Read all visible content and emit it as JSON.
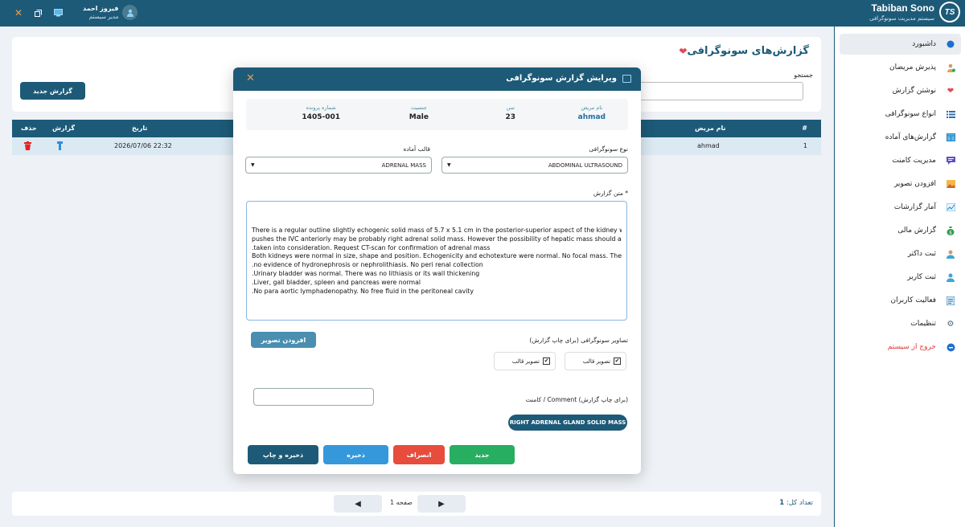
{
  "topbar": {
    "brand_title": "Tabiban Sono",
    "brand_subtitle": "سیستم مدیریت سونوگرافی",
    "logo_text": "TS",
    "user_name": "فیروز احمد",
    "user_role": "مدیر سیستم"
  },
  "sidebar": {
    "items": [
      {
        "label": "داشبورد",
        "icon": "dashboard-icon"
      },
      {
        "label": "پذیرش مریضان",
        "icon": "patient-add-icon"
      },
      {
        "label": "نوشتن گزارش",
        "icon": "heart-icon"
      },
      {
        "label": "انواع سونوگرافی",
        "icon": "list-icon"
      },
      {
        "label": "گزارش‌های آماده",
        "icon": "template-icon"
      },
      {
        "label": "مدیریت کامنت",
        "icon": "comment-icon"
      },
      {
        "label": "افزودن تصویر",
        "icon": "image-icon"
      },
      {
        "label": "آمار گزارشات",
        "icon": "chart-icon"
      },
      {
        "label": "گزارش مالی",
        "icon": "money-icon"
      },
      {
        "label": "ثبت داکتر",
        "icon": "doctor-icon"
      },
      {
        "label": "ثبت کاربر",
        "icon": "user-icon"
      },
      {
        "label": "فعالیت کاربران",
        "icon": "activity-icon"
      },
      {
        "label": "تنظیمات",
        "icon": "gear-icon"
      },
      {
        "label": "خروج از سیستم",
        "icon": "logout-icon"
      }
    ]
  },
  "page": {
    "title": "گزارش‌های سونوگرافی",
    "search_label": "جستجو",
    "new_report_button": "گزارش جدید"
  },
  "table": {
    "headers": {
      "index": "#",
      "patient": "نام مریض",
      "date": "تاریخ",
      "report": "گزارش",
      "delete": "حذف"
    },
    "rows": [
      {
        "index": "1",
        "patient": "ahmad",
        "date": "2026/07/06 22:32"
      }
    ]
  },
  "pagination": {
    "page_label": "صفحه 1",
    "total_label": "تعداد کل:",
    "total_value": "1"
  },
  "modal": {
    "title": "ویرایش گزارش سونوگرافی",
    "patient_info": {
      "name_label": "نام مریض",
      "name": "ahmad",
      "age_label": "سن",
      "age": "23",
      "gender_label": "جنسیت",
      "gender": "Male",
      "file_label": "شماره پرونده",
      "file_no": "1405-001"
    },
    "sono_type_label": "نوع سونوگرافی",
    "sono_type_value": "ABDOMINAL ULTRASOUND",
    "template_label": "قالب آماده",
    "template_value": "ADRENAL MASS",
    "report_text_label": "متن گزارش *",
    "report_lines": [
      "There is a regular outline slightly echogenic solid mass of 5.7 x 5.1 cm in the posterior-superior aspect of the kidney which",
      "pushes the IVC anteriorly may be probably right adrenal solid mass. However the possibility of hepatic mass should also be",
      ".taken into consideration. Request CT-scan for confirmation of adrenal mass",
      "Both kidneys were normal in size, shape and position. Echogenicity and echotexture were normal. No focal mass. There was",
      ".no evidence of hydronephrosis or nephrolithiasis. No peri renal collection",
      ".Urinary bladder was normal. There was no lithiasis or its wall thickening",
      ".Liver, gall bladder, spleen and pancreas were normal",
      ".No para aortic lymphadenopathy. No free fluid in the peritoneal cavity"
    ],
    "images_label": "تصاویر سونوگرافی (برای چاپ گزارش)",
    "add_image_button": "افزودن تصویر",
    "image_checks": [
      {
        "label": "تصویر قالب",
        "checked": true
      },
      {
        "label": "تصویر قالب",
        "checked": true
      }
    ],
    "comment_label": "کامنت / Comment (برای چاپ گزارش)",
    "comment_chip": "RIGHT ADRENAL GLAND SOLID MASS",
    "buttons": {
      "new": "جدید",
      "cancel": "انصراف",
      "save": "ذخیره",
      "save_print": "ذخیره و چاپ"
    }
  },
  "colors": {
    "primary": "#1d5a78",
    "green": "#27ae60",
    "red": "#e74c3c",
    "blue": "#3498db",
    "steel": "#4a8fb0"
  }
}
